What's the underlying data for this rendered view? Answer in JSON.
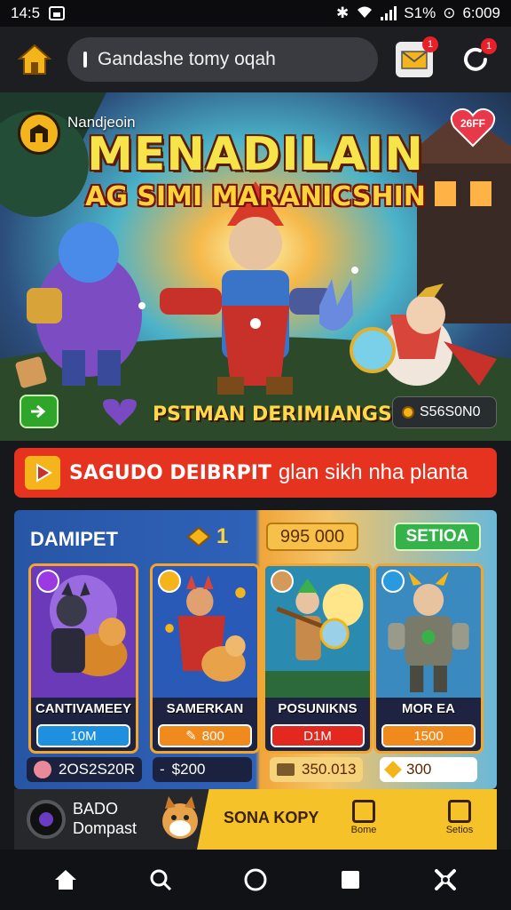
{
  "status_bar": {
    "time": "14:5",
    "battery": "S1%",
    "clock": "6:009"
  },
  "top_bar": {
    "search_text": "Gandashe tomy oqah",
    "mail_badge": "1",
    "refresh_badge": "1"
  },
  "hero": {
    "logo_text": "Nandjeoin",
    "title": "MENADILAIN",
    "subtitle": "AG SIMI MARANICSHIN",
    "heart_label": "26FF",
    "caption": "PSTMAN DERIMIANGS",
    "counter": "S56S0N0"
  },
  "promo": {
    "bold": "SAGUDO DEIBRPIT",
    "text": "glan sikh nha planta"
  },
  "shop": {
    "title": "DAMIPET",
    "gem_count": "1",
    "price_pill": "995 000",
    "green_pill": "SETIOA",
    "cards": [
      {
        "name": "CANTIVAMEEY",
        "button": "10M"
      },
      {
        "name": "SAMERKAN",
        "button": "800"
      },
      {
        "name": "POSUNIKNS",
        "button": "D1M"
      },
      {
        "name": "MOR EA",
        "button": "1500"
      }
    ],
    "price_tags": [
      "2OS2S20R",
      "$200",
      "350.013",
      "300"
    ],
    "price_tag_prefix": "-"
  },
  "ad_strip": {
    "name_line1": "BADO",
    "name_line2": "Dompast",
    "text": "SONA KOPY",
    "icon1_label": "Bome",
    "icon2_label": "Setios"
  },
  "colors": {
    "accent_yellow": "#f3b51b",
    "promo_red": "#e6331f",
    "panel_blue": "#2856a6",
    "panel_orange": "#f0a53a"
  },
  "icons": [
    "home-icon",
    "search-icon",
    "circle-icon",
    "square-icon",
    "tools-icon",
    "mail-icon",
    "refresh-icon",
    "play-icon",
    "gem-icon",
    "coin-icon"
  ]
}
